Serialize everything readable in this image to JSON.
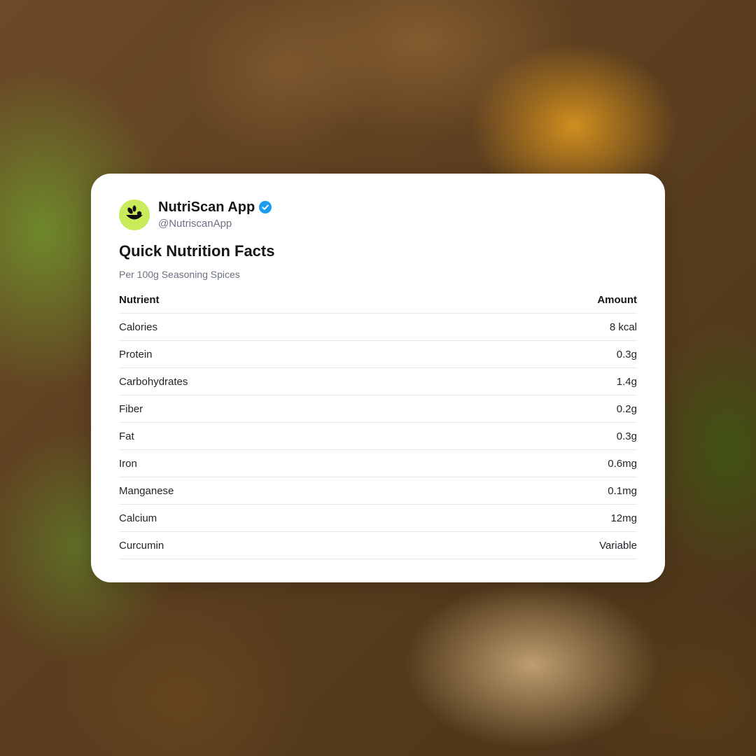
{
  "profile": {
    "name": "NutriScan App",
    "handle": "@NutriscanApp",
    "verified": true,
    "avatar_color": "#c8ec5a",
    "verified_color": "#1d9bf0"
  },
  "card": {
    "title": "Quick Nutrition Facts",
    "subtitle": "Per 100g Seasoning Spices"
  },
  "table": {
    "headers": {
      "nutrient": "Nutrient",
      "amount": "Amount"
    },
    "rows": [
      {
        "nutrient": "Calories",
        "amount": "8 kcal"
      },
      {
        "nutrient": "Protein",
        "amount": "0.3g"
      },
      {
        "nutrient": "Carbohydrates",
        "amount": "1.4g"
      },
      {
        "nutrient": "Fiber",
        "amount": "0.2g"
      },
      {
        "nutrient": "Fat",
        "amount": "0.3g"
      },
      {
        "nutrient": "Iron",
        "amount": "0.6mg"
      },
      {
        "nutrient": "Manganese",
        "amount": "0.1mg"
      },
      {
        "nutrient": "Calcium",
        "amount": "12mg"
      },
      {
        "nutrient": "Curcumin",
        "amount": "Variable"
      }
    ]
  }
}
